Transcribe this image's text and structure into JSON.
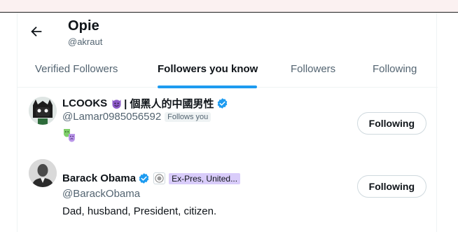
{
  "profile": {
    "name": "Opie",
    "handle": "@akraut"
  },
  "tabs": [
    {
      "label": "Verified Followers",
      "active": false
    },
    {
      "label": "Followers you know",
      "active": true
    },
    {
      "label": "Followers",
      "active": false
    },
    {
      "label": "Following",
      "active": false
    }
  ],
  "accent_color": "#1d9bf0",
  "users": [
    {
      "name": "LCOOKS",
      "name_suffix": "| 個黑人的中國男性",
      "handle": "@Lamar0985056592",
      "follows_you": "Follows you",
      "verified": true,
      "button": "Following",
      "bio_icons": [
        "green-mask-icon",
        "purple-mask-icon"
      ]
    },
    {
      "name": "Barack Obama",
      "handle": "@BarackObama",
      "verified": true,
      "affiliation": "Ex-Pres, United...",
      "bio": "Dad, husband, President, citizen.",
      "button": "Following"
    }
  ]
}
